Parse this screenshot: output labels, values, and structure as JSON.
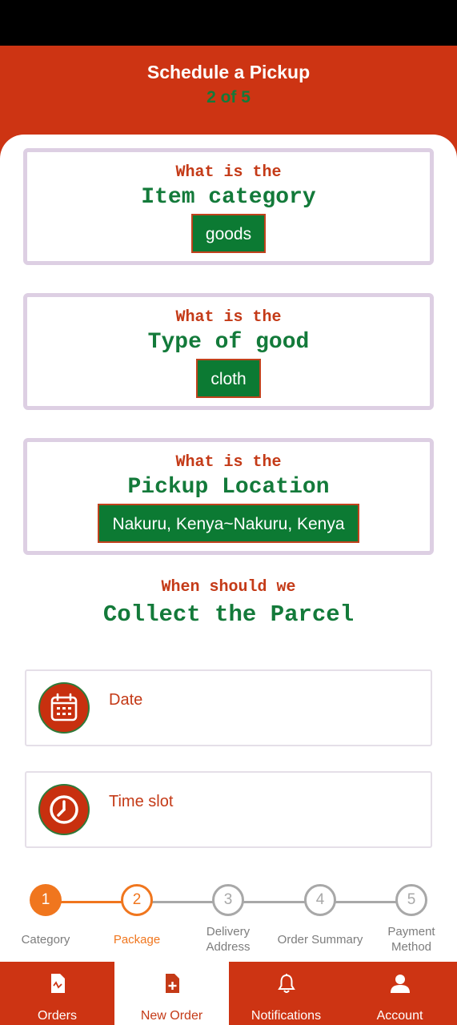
{
  "header": {
    "title": "Schedule a Pickup",
    "step": "2 of 5"
  },
  "questions": [
    {
      "prompt": "What is the",
      "field": "Item category",
      "value": "goods"
    },
    {
      "prompt": "What is the",
      "field": "Type of good",
      "value": "cloth"
    },
    {
      "prompt": "What is the",
      "field": "Pickup Location",
      "value": "Nakuru, Kenya~Nakuru, Kenya"
    }
  ],
  "collect": {
    "prompt": "When should we",
    "title": "Collect the Parcel"
  },
  "pickers": [
    {
      "label": "Date",
      "icon": "calendar-icon"
    },
    {
      "label": "Time slot",
      "icon": "clock-icon"
    }
  ],
  "stepper": {
    "steps": [
      {
        "number": "1",
        "label": "Category",
        "state": "done"
      },
      {
        "number": "2",
        "label": "Package",
        "state": "current"
      },
      {
        "number": "3",
        "label": "Delivery Address",
        "state": "todo"
      },
      {
        "number": "4",
        "label": "Order Summary",
        "state": "todo"
      },
      {
        "number": "5",
        "label": "Payment Method",
        "state": "todo"
      }
    ]
  },
  "nav": [
    {
      "label": "Orders",
      "icon": "receipt-icon"
    },
    {
      "label": "New Order",
      "icon": "add-document-icon",
      "active": true
    },
    {
      "label": "Notifications",
      "icon": "bell-icon"
    },
    {
      "label": "Account",
      "icon": "person-icon"
    }
  ],
  "colors": {
    "brand": "#cd3413",
    "green": "#137a3a",
    "accent": "#f0761e",
    "inactive": "#a8a8a8"
  }
}
